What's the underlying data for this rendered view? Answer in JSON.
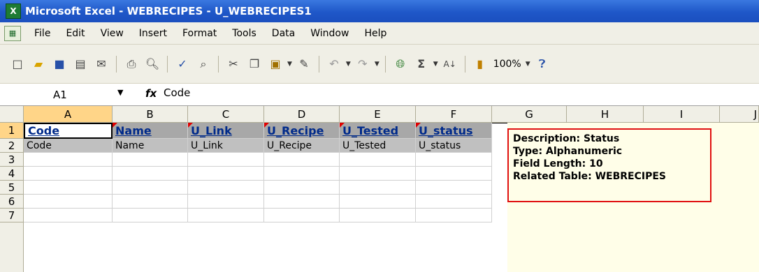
{
  "window": {
    "title": "Microsoft Excel - WEBRECIPES - U_WEBRECIPES1"
  },
  "menu": [
    "File",
    "Edit",
    "View",
    "Insert",
    "Format",
    "Tools",
    "Data",
    "Window",
    "Help"
  ],
  "toolbar": {
    "zoom": "100%"
  },
  "formula_bar": {
    "name_box": "A1",
    "fx": "fx",
    "value": "Code"
  },
  "columns": [
    "A",
    "B",
    "C",
    "D",
    "E",
    "F",
    "G",
    "H",
    "I",
    "J"
  ],
  "rows": [
    "1",
    "2",
    "3",
    "4",
    "5",
    "6",
    "7"
  ],
  "row1": [
    "Code",
    "Name",
    "U_Link",
    "U_Recipe",
    "U_Tested",
    "U_status"
  ],
  "row2": [
    "Code",
    "Name",
    "U_Link",
    "U_Recipe",
    "U_Tested",
    "U_status"
  ],
  "comment": {
    "line1": "Description: Status",
    "line2": "Type: Alphanumeric",
    "line3": "Field Length: 10",
    "line4": "Related Table: WEBRECIPES"
  }
}
